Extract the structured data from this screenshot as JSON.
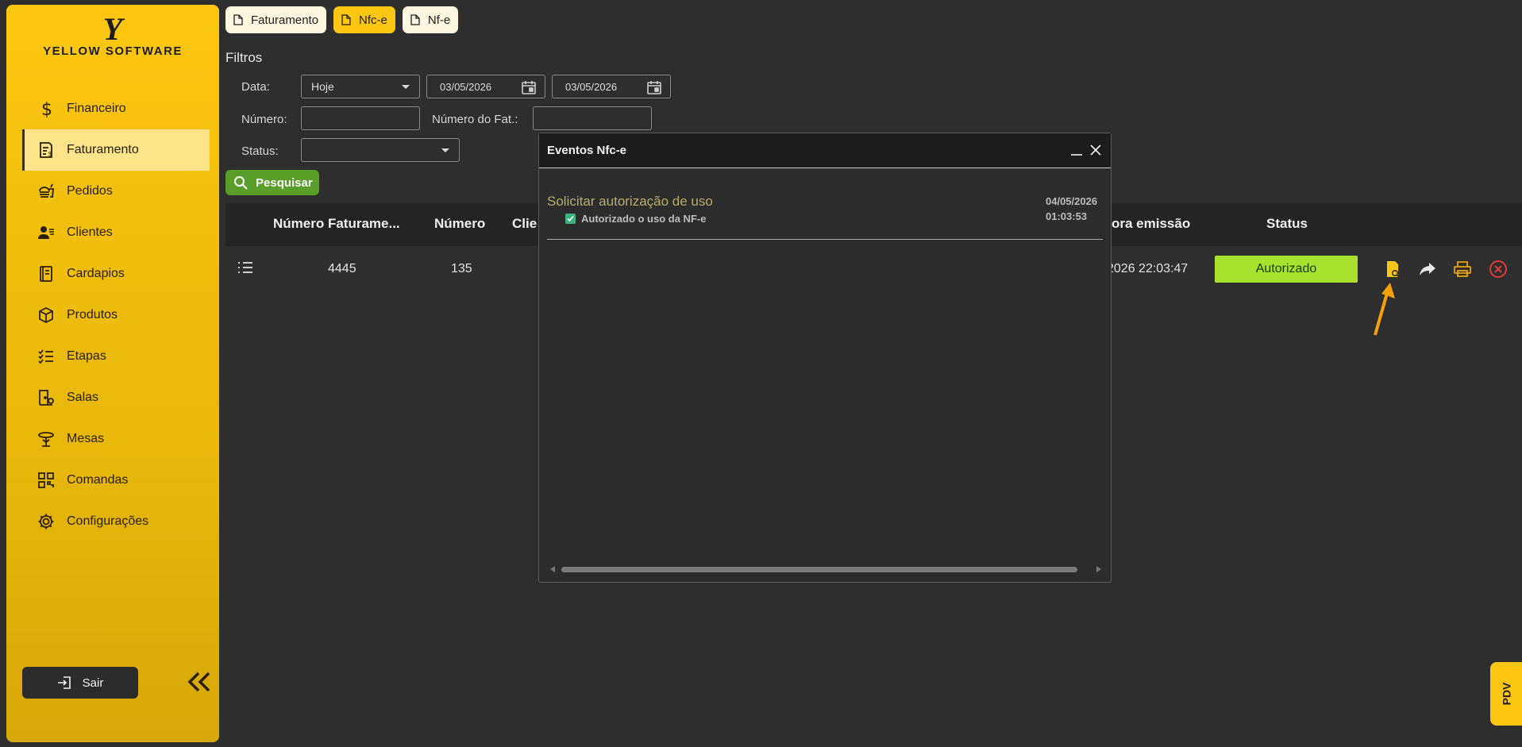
{
  "brand": {
    "mark": "Y",
    "name": "YELLOW SOFTWARE"
  },
  "sidebar": {
    "items": [
      {
        "label": "Financeiro",
        "icon": "dollar-icon"
      },
      {
        "label": "Faturamento",
        "icon": "invoice-icon",
        "active": true
      },
      {
        "label": "Pedidos",
        "icon": "food-icon"
      },
      {
        "label": "Clientes",
        "icon": "clients-icon"
      },
      {
        "label": "Cardapios",
        "icon": "menu-book-icon"
      },
      {
        "label": "Produtos",
        "icon": "box-icon"
      },
      {
        "label": "Etapas",
        "icon": "checklist-icon"
      },
      {
        "label": "Salas",
        "icon": "room-icon"
      },
      {
        "label": "Mesas",
        "icon": "table-icon"
      },
      {
        "label": "Comandas",
        "icon": "qr-icon"
      },
      {
        "label": "Configurações",
        "icon": "gear-icon"
      }
    ],
    "logout_label": "Sair"
  },
  "tabs": [
    {
      "label": "Faturamento"
    },
    {
      "label": "Nfc-e",
      "active": true
    },
    {
      "label": "Nf-e"
    }
  ],
  "filters": {
    "title": "Filtros",
    "date_label": "Data:",
    "date_period": "Hoje",
    "date_from": "03/05/2026",
    "date_to": "03/05/2026",
    "number_label": "Número:",
    "number_value": "",
    "invoice_number_label": "Número do Fat.:",
    "invoice_number_value": "",
    "status_label": "Status:",
    "status_value": "",
    "search_label": "Pesquisar"
  },
  "table": {
    "headers": {
      "invoice_number": "Número Faturame...",
      "number": "Número",
      "client": "Clie",
      "emission": "ora emissão",
      "status": "Status"
    },
    "rows": [
      {
        "invoice_number": "4445",
        "number": "135",
        "emission": "2026 22:03:47",
        "status": "Autorizado"
      }
    ]
  },
  "modal": {
    "title": "Eventos Nfc-e",
    "event": {
      "title": "Solicitar autorização de uso",
      "detail": "Autorizado o uso da NF-e",
      "date": "04/05/2026",
      "time": "01:03:53"
    }
  },
  "pdv_label": "PDV",
  "colors": {
    "accent": "#fcc712",
    "success": "#a8e22e",
    "search_button": "#5a9e2a",
    "event_title": "#b7ad6b",
    "cancel": "#e23b3b"
  }
}
